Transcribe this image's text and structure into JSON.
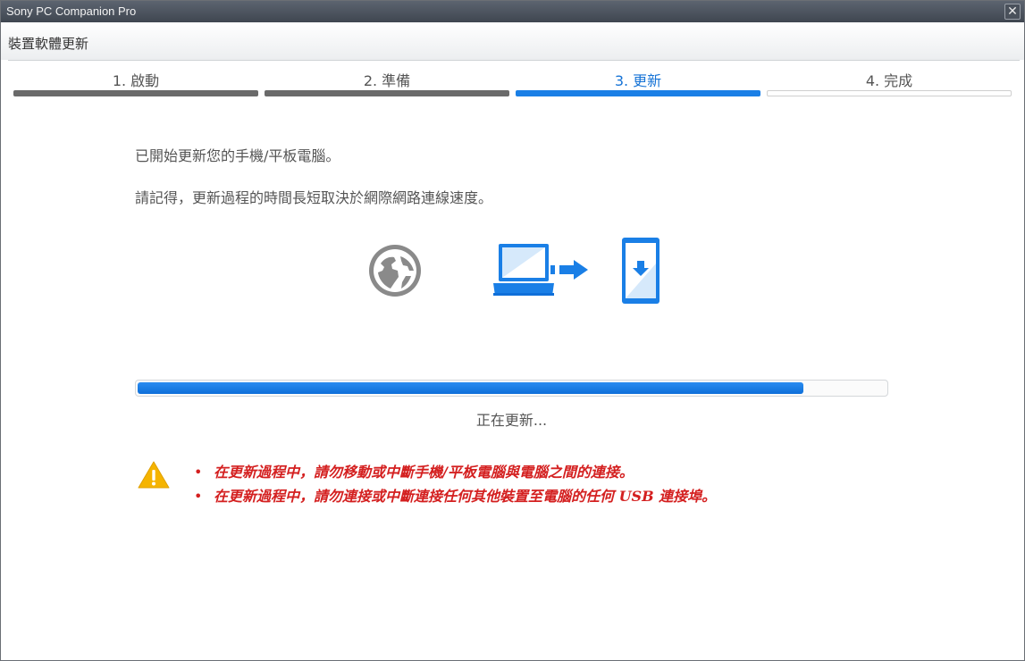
{
  "window": {
    "title": "Sony PC Companion Pro",
    "close_label": "✕"
  },
  "page": {
    "title": "裝置軟體更新"
  },
  "steps": [
    {
      "label": "1. 啟動",
      "state": "done"
    },
    {
      "label": "2. 準備",
      "state": "done"
    },
    {
      "label": "3. 更新",
      "state": "active"
    },
    {
      "label": "4. 完成",
      "state": "todo"
    }
  ],
  "messages": {
    "line1": "已開始更新您的手機/平板電腦。",
    "line2": "請記得，更新過程的時間長短取決於網際網路連線速度。"
  },
  "icons": [
    "globe-icon",
    "laptop-transfer-icon",
    "phone-download-icon",
    "warning-icon"
  ],
  "progress": {
    "percent": 89,
    "status_text": "正在更新..."
  },
  "warnings": [
    "在更新過程中，請勿移動或中斷手機/平板電腦與電腦之間的連接。",
    "在更新過程中，請勿連接或中斷連接任何其他裝置至電腦的任何 USB 連接埠。"
  ],
  "colors": {
    "accent": "#1a7fe6",
    "warning_text": "#d42020",
    "done_step": "#6a6a6a",
    "globe": "#8a8a8a"
  }
}
